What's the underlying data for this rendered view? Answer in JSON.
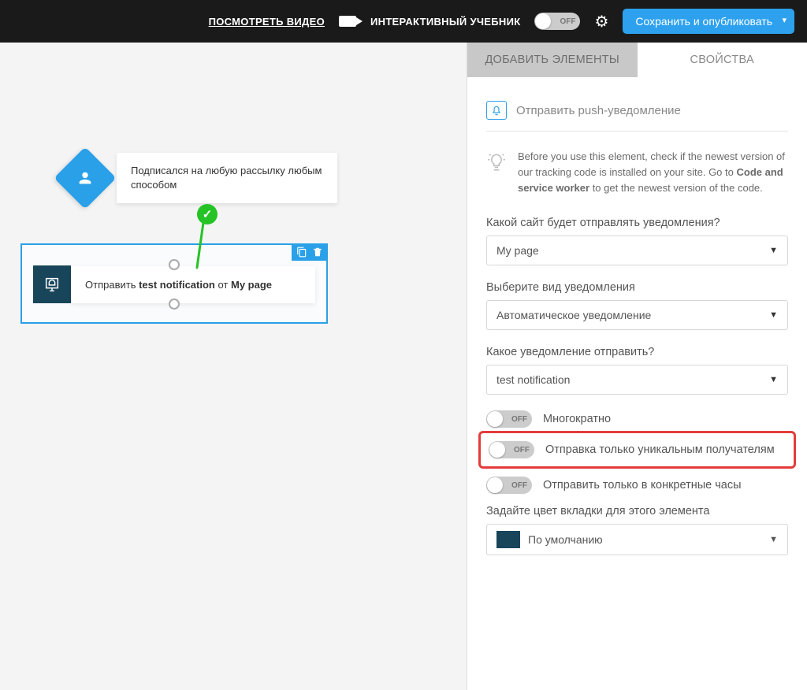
{
  "topbar": {
    "watch_video": "ПОСМОТРЕТЬ ВИДЕО",
    "interactive_tutorial": "ИНТЕРАКТИВНЫЙ УЧЕБНИК",
    "tutorial_toggle": "OFF",
    "publish": "Сохранить и опубликовать"
  },
  "canvas": {
    "trigger_text": "Подписался на любую рассылку любым способом",
    "action_prefix": "Отправить ",
    "action_bold1": "test notification",
    "action_mid": " от ",
    "action_bold2": "My page"
  },
  "panel": {
    "tabs": {
      "add": "ДОБАВИТЬ ЭЛЕМЕНТЫ",
      "props": "СВОЙСТВА"
    },
    "title": "Отправить push-уведомление",
    "info_before": "Before you use this element, check if the newest version of our tracking code is installed on your site. Go to ",
    "info_bold": "Code and service worker",
    "info_after": " to get the newest version of the code.",
    "q_site": "Какой сайт будет отправлять уведомления?",
    "site_value": "My page",
    "q_type": "Выберите вид уведомления",
    "type_value": "Автоматическое уведомление",
    "q_which": "Какое уведомление отправить?",
    "which_value": "test notification",
    "toggle1": {
      "state": "OFF",
      "label": "Многократно"
    },
    "toggle2": {
      "state": "OFF",
      "label": "Отправка только уникальным получателям"
    },
    "toggle3": {
      "state": "OFF",
      "label": "Отправить только в конкретные часы"
    },
    "q_color": "Задайте цвет вкладки для этого элемента",
    "color_value": "По умолчанию"
  }
}
